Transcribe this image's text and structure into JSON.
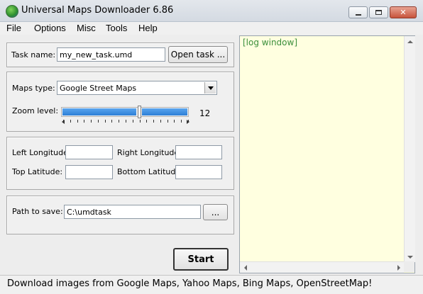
{
  "window": {
    "title": "Universal Maps Downloader 6.86",
    "minimize_label": "Minimize",
    "maximize_label": "Maximize",
    "close_label": "Close"
  },
  "menu": {
    "items": [
      "File",
      "Options",
      "Misc",
      "Tools",
      "Help"
    ]
  },
  "task": {
    "label": "Task name:",
    "value": "my_new_task.umd",
    "open_button": "Open task ..."
  },
  "maps": {
    "type_label": "Maps type:",
    "type_value": "Google Street Maps",
    "zoom_label": "Zoom level:",
    "zoom_value": "12"
  },
  "coords": {
    "left_longitude_label": "Left Longitude:",
    "right_longitude_label": "Right Longitude:",
    "top_latitude_label": "Top Latitude:",
    "bottom_latitude_label": "Bottom Latitude:",
    "left_longitude_value": "",
    "right_longitude_value": "",
    "top_latitude_value": "",
    "bottom_latitude_value": ""
  },
  "save": {
    "label": "Path to save:",
    "value": "C:\\umdtask",
    "browse_button": "..."
  },
  "actions": {
    "start_button": "Start"
  },
  "log": {
    "text": "[log window]"
  },
  "status": {
    "text": "Download images from Google Maps, Yahoo Maps, Bing Maps, OpenStreetMap!"
  },
  "colors": {
    "log_background": "#ffffe0",
    "log_text": "#3b8f3b",
    "slider_fill": "#2d7fd6"
  }
}
